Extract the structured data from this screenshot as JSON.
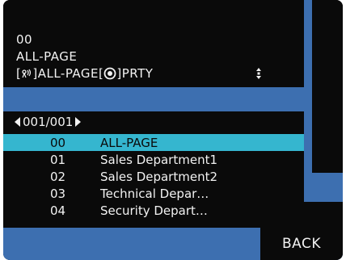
{
  "info": {
    "number": "00",
    "name": "ALL-PAGE",
    "detail_prefix": "[",
    "detail_mid": "]ALL-PAGE[",
    "detail_suffix": "]PRTY"
  },
  "pager": {
    "text": "001/001"
  },
  "list": [
    {
      "num": "00",
      "name": "ALL-PAGE"
    },
    {
      "num": "01",
      "name": "Sales Department1"
    },
    {
      "num": "02",
      "name": "Sales Department2"
    },
    {
      "num": "03",
      "name": "Technical Depar…"
    },
    {
      "num": "04",
      "name": "Security Depart…"
    }
  ],
  "selected_index": 0,
  "back_label": "BACK",
  "colors": {
    "accent": "#35b6cf",
    "blue": "#3d6fb0",
    "bg": "#0a0a0a"
  },
  "icons": [
    "book-icon",
    "broadcast-icon",
    "target-icon",
    "scroll-icon",
    "arrow-left-icon",
    "arrow-right-icon"
  ]
}
